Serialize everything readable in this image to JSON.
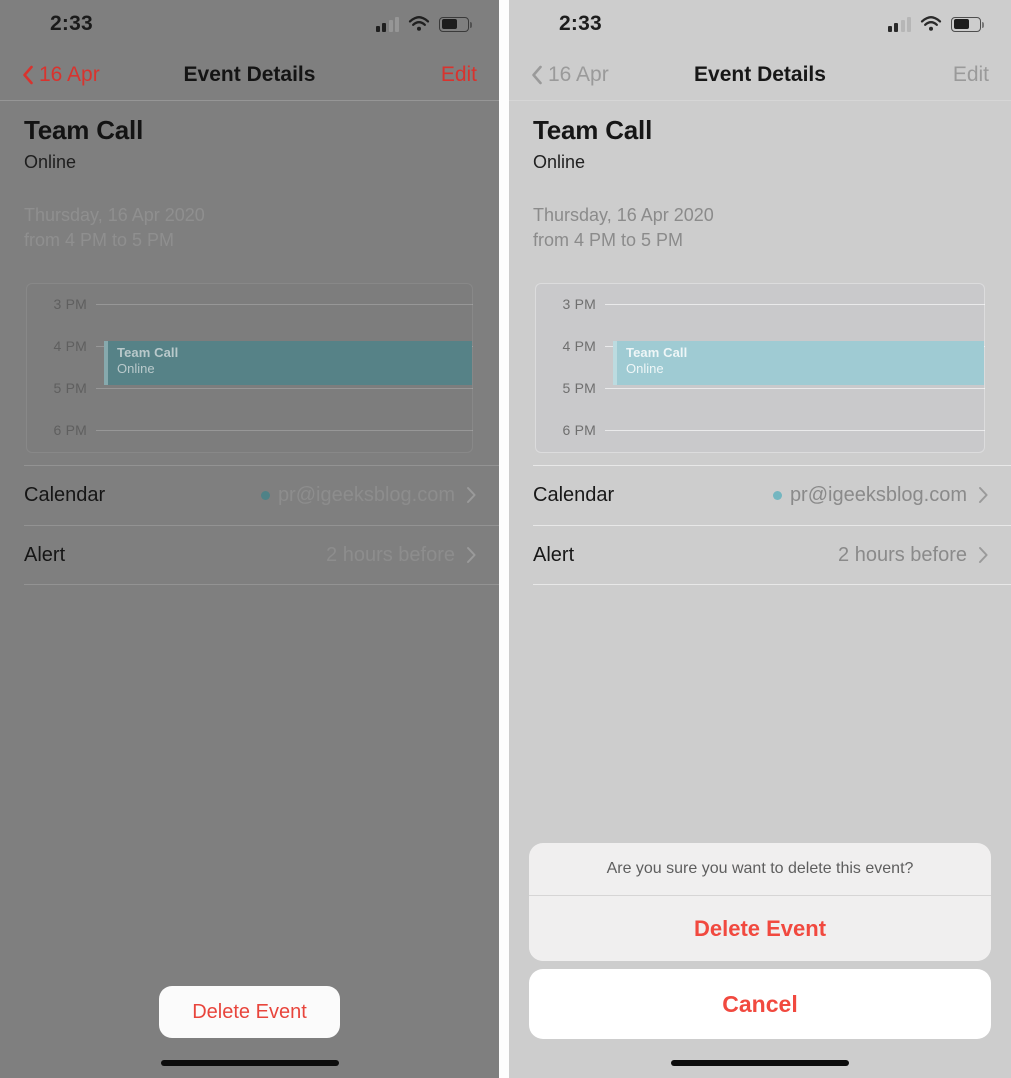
{
  "accent_colors": {
    "destructive_red": "#e8453c",
    "sheet_red": "#f1493f",
    "nav_red": "#d9332e",
    "event_teal_left": "#568287",
    "event_teal_right": "#9fcbd3",
    "calendar_dot_left": "#4f8287",
    "calendar_dot_right": "#74b6c0",
    "panel_bg_left": "#7f7f7f",
    "panel_bg_right": "#cdcdcd"
  },
  "status_bar": {
    "time": "2:33",
    "cellular_icon": "cellular-bars-icon",
    "cellular_bars_filled": 2,
    "cellular_bars_total": 4,
    "wifi_icon": "wifi-icon",
    "battery_icon": "battery-icon",
    "battery_percent": 63
  },
  "nav_bar": {
    "back_icon": "chevron-left-icon",
    "back_label": "16 Apr",
    "title": "Event Details",
    "edit_label": "Edit"
  },
  "event": {
    "title": "Team Call",
    "location": "Online",
    "date_line": "Thursday, 16 Apr 2020",
    "time_line": "from 4 PM to 5 PM"
  },
  "timeline": {
    "hour_labels": [
      "3 PM",
      "4 PM",
      "5 PM",
      "6 PM"
    ],
    "event_block": {
      "title": "Team Call",
      "subtitle": "Online",
      "start_label": "4 PM",
      "end_label": "5 PM"
    }
  },
  "detail_rows": [
    {
      "label": "Calendar",
      "value": "pr@igeeksblog.com",
      "has_dot": true,
      "chevron_icon": "chevron-right-icon"
    },
    {
      "label": "Alert",
      "value": "2 hours before",
      "has_dot": false,
      "chevron_icon": "chevron-right-icon"
    }
  ],
  "left_panel": {
    "delete_button_label": "Delete Event"
  },
  "right_panel": {
    "action_sheet": {
      "message": "Are you sure you want to delete this event?",
      "destructive_label": "Delete Event",
      "cancel_label": "Cancel"
    }
  },
  "home_indicator": "home-indicator"
}
